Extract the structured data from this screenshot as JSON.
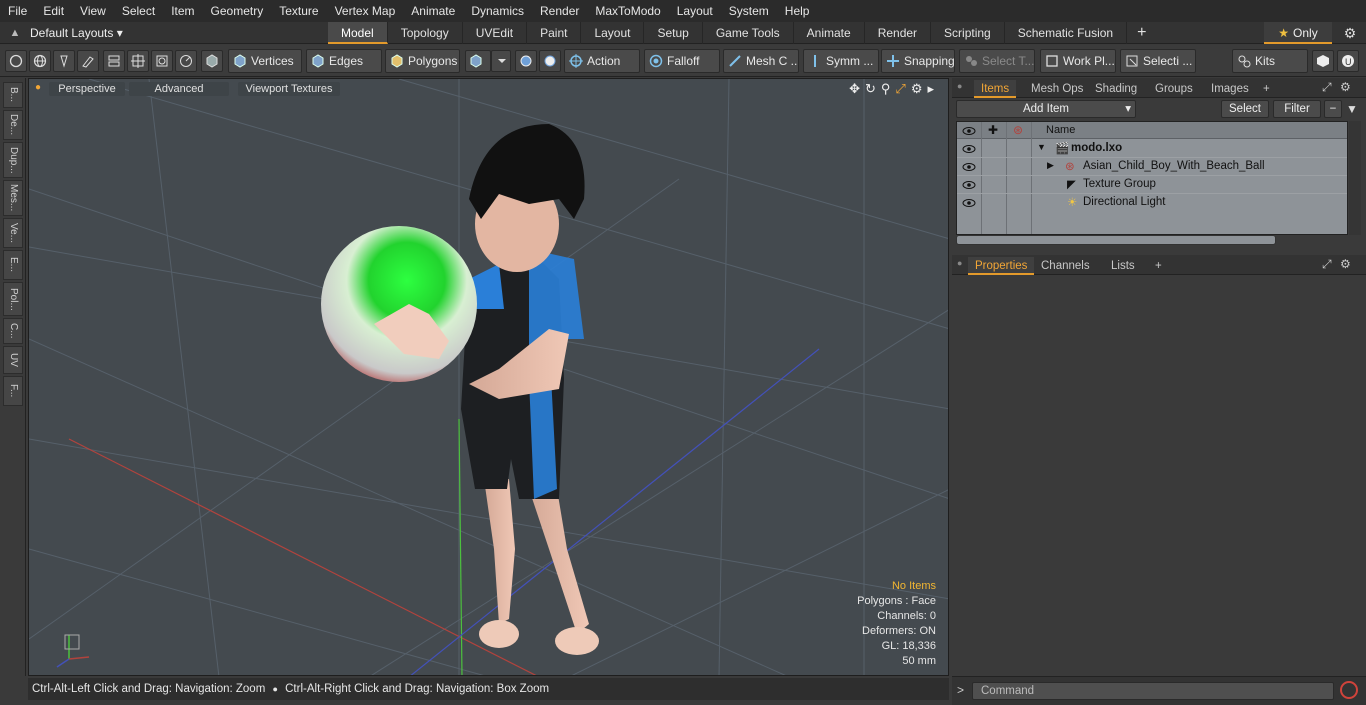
{
  "menu": [
    "File",
    "Edit",
    "View",
    "Select",
    "Item",
    "Geometry",
    "Texture",
    "Vertex Map",
    "Animate",
    "Dynamics",
    "Render",
    "MaxToModo",
    "Layout",
    "System",
    "Help"
  ],
  "layout_select": "Default Layouts ▾",
  "tabs": [
    "Model",
    "Topology",
    "UVEdit",
    "Paint",
    "Layout",
    "Setup",
    "Game Tools",
    "Animate",
    "Render",
    "Scripting",
    "Schematic Fusion"
  ],
  "tab_plus": "+",
  "only_label": "Only",
  "toolbar": {
    "vertices": "Vertices",
    "edges": "Edges",
    "polygons": "Polygons",
    "action": "Action",
    "falloff": "Falloff",
    "mesh_c": "Mesh C ...",
    "symm": "Symm ...",
    "snapping": "Snapping",
    "select_t": "Select T...",
    "work_pl": "Work Pl...",
    "selecti": "Selecti ...",
    "kits": "Kits"
  },
  "left_tabs": [
    "B...",
    "De...",
    "Dup...",
    "Mes...",
    "Ve...",
    "E...",
    "Pol...",
    "C...",
    "UV",
    "F..."
  ],
  "viewport": {
    "perspective": "Perspective",
    "advanced": "Advanced",
    "textures": "Viewport Textures",
    "hud": {
      "no_items": "No Items",
      "polygons": "Polygons : Face",
      "channels": "Channels: 0",
      "deformers": "Deformers: ON",
      "gl": "GL: 18,336",
      "focal": "50 mm"
    }
  },
  "status_left": "Ctrl-Alt-Left Click and Drag: Navigation: Zoom",
  "status_right": "Ctrl-Alt-Right Click and Drag: Navigation: Box Zoom",
  "items_panel": {
    "tabs": [
      "Items",
      "Mesh Ops",
      "Shading",
      "Groups",
      "Images"
    ],
    "add_item": "Add Item",
    "select": "Select",
    "filter": "Filter",
    "col_name": "Name",
    "rows": [
      {
        "name": "modo.lxo"
      },
      {
        "name": "Asian_Child_Boy_With_Beach_Ball"
      },
      {
        "name": "Texture Group"
      },
      {
        "name": "Directional Light"
      }
    ]
  },
  "props_panel": {
    "tabs": [
      "Properties",
      "Channels",
      "Lists"
    ]
  },
  "command_placeholder": "Command"
}
